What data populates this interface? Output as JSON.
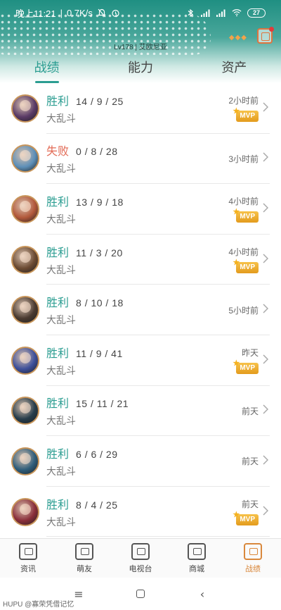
{
  "status_bar": {
    "time": "晚上11:21",
    "net_speed": "0.7K/s",
    "battery": "27",
    "icons": [
      "mute-bell-icon",
      "alarm-icon",
      "bluetooth-icon",
      "signal-icon",
      "signal-icon",
      "wifi-icon"
    ]
  },
  "header": {
    "level_text": "Lv178 | 艾欧尼亚",
    "icon": "bag-icon"
  },
  "tabs": [
    {
      "label": "战绩",
      "active": true
    },
    {
      "label": "能力",
      "active": false
    },
    {
      "label": "资产",
      "active": false
    }
  ],
  "matches": [
    {
      "result": "胜利",
      "kda": "14 / 9 / 25",
      "mode": "大乱斗",
      "time": "2小时前",
      "mvp": "MVP",
      "avatar_color": "#5a3a66"
    },
    {
      "result": "失败",
      "kda": "0 / 8 / 28",
      "mode": "大乱斗",
      "time": "3小时前",
      "mvp": "",
      "avatar_color": "#5d8fb8"
    },
    {
      "result": "胜利",
      "kda": "13 / 9 / 18",
      "mode": "大乱斗",
      "time": "4小时前",
      "mvp": "MVP",
      "avatar_color": "#b2583a"
    },
    {
      "result": "胜利",
      "kda": "11 / 3 / 20",
      "mode": "大乱斗",
      "time": "4小时前",
      "mvp": "MVP",
      "avatar_color": "#6b4a32"
    },
    {
      "result": "胜利",
      "kda": "8 / 10 / 18",
      "mode": "大乱斗",
      "time": "5小时前",
      "mvp": "",
      "avatar_color": "#4a3a30"
    },
    {
      "result": "胜利",
      "kda": "11 / 9 / 41",
      "mode": "大乱斗",
      "time": "昨天",
      "mvp": "MVP",
      "avatar_color": "#3d4f9a"
    },
    {
      "result": "胜利",
      "kda": "15 / 11 / 21",
      "mode": "大乱斗",
      "time": "前天",
      "mvp": "",
      "avatar_color": "#263c4a"
    },
    {
      "result": "胜利",
      "kda": "6 / 6 / 29",
      "mode": "大乱斗",
      "time": "前天",
      "mvp": "",
      "avatar_color": "#2f5d7a"
    },
    {
      "result": "胜利",
      "kda": "8 / 4 / 25",
      "mode": "大乱斗",
      "time": "前天",
      "mvp": "MVP",
      "avatar_color": "#8a2f3a"
    }
  ],
  "bottom_nav": [
    {
      "label": "资讯",
      "icon": "news-icon",
      "active": false
    },
    {
      "label": "萌友",
      "icon": "friends-icon",
      "active": false
    },
    {
      "label": "电视台",
      "icon": "tv-icon",
      "active": false
    },
    {
      "label": "商城",
      "icon": "shop-icon",
      "active": false
    },
    {
      "label": "战绩",
      "icon": "records-icon",
      "active": true
    }
  ],
  "system_nav": {
    "menu_icon": "≡",
    "back_icon": "‹"
  },
  "watermark": "HUPU @寡荣凭借记忆",
  "colors": {
    "accent": "#2b9d91",
    "loss": "#e26a55",
    "nav_active": "#d9883c",
    "mvp": "#e39b1d"
  }
}
